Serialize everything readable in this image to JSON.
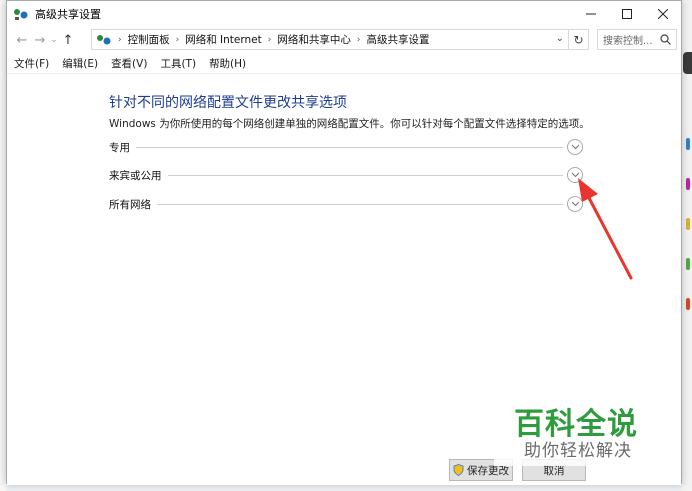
{
  "window": {
    "title": "高级共享设置"
  },
  "address_bar": {
    "breadcrumbs": [
      "控制面板",
      "网络和 Internet",
      "网络和共享中心",
      "高级共享设置"
    ]
  },
  "search": {
    "placeholder": "搜索控制..."
  },
  "menu": {
    "items": [
      "文件(F)",
      "编辑(E)",
      "查看(V)",
      "工具(T)",
      "帮助(H)"
    ]
  },
  "main": {
    "heading": "针对不同的网络配置文件更改共享选项",
    "description": "Windows 为你所使用的每个网络创建单独的网络配置文件。你可以针对每个配置文件选择特定的选项。",
    "sections": [
      {
        "label": "专用"
      },
      {
        "label": "来宾或公用"
      },
      {
        "label": "所有网络"
      }
    ]
  },
  "footer": {
    "save_label": "保存更改",
    "cancel_label": "取消"
  },
  "watermark": {
    "main": "百科全说",
    "sub": "助你轻松解决"
  },
  "colors": {
    "heading": "#1e3d8f",
    "annotation_arrow": "#e8362f",
    "watermark_green": "#2e9c3d"
  }
}
